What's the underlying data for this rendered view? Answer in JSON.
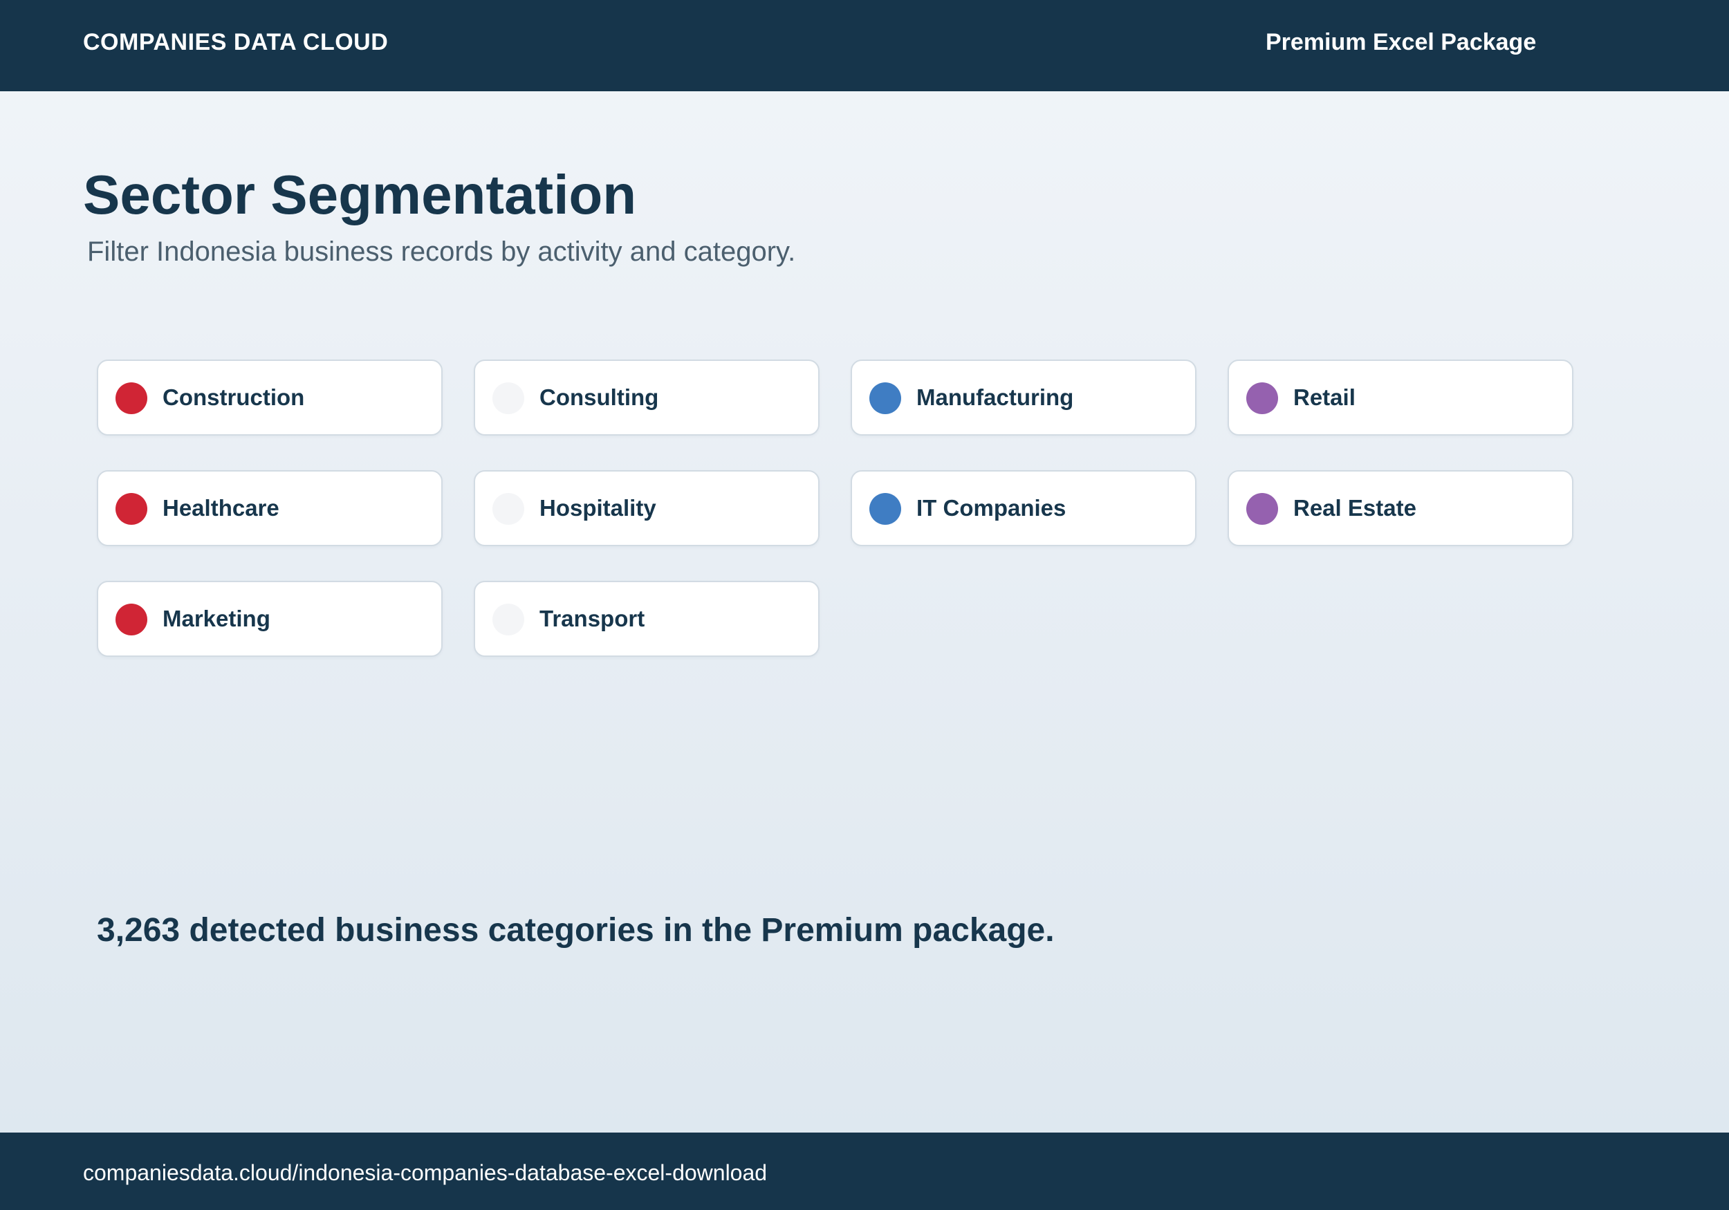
{
  "header": {
    "brand": "COMPANIES DATA CLOUD",
    "package": "Premium Excel Package",
    "background_color": "#16354b"
  },
  "main": {
    "title": "Sector Segmentation",
    "subtitle": "Filter Indonesia business records by activity and category."
  },
  "sectors": [
    {
      "label": "Construction",
      "dot_color": "#d02535"
    },
    {
      "label": "Consulting",
      "dot_color": "#f4f5f7"
    },
    {
      "label": "Manufacturing",
      "dot_color": "#3f7dc3"
    },
    {
      "label": "Retail",
      "dot_color": "#9561af"
    },
    {
      "label": "Healthcare",
      "dot_color": "#d02535"
    },
    {
      "label": "Hospitality",
      "dot_color": "#f4f5f7"
    },
    {
      "label": "IT Companies",
      "dot_color": "#3f7dc3"
    },
    {
      "label": "Real Estate",
      "dot_color": "#9561af"
    },
    {
      "label": "Marketing",
      "dot_color": "#d02535"
    },
    {
      "label": "Transport",
      "dot_color": "#f4f5f7"
    }
  ],
  "summary": "3,263 detected business categories in the Premium package.",
  "footer": {
    "url": "companiesdata.cloud/indonesia-companies-database-excel-download"
  }
}
